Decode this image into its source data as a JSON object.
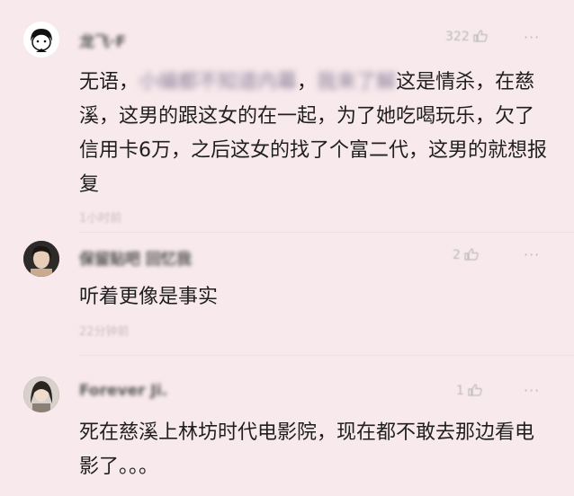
{
  "comments": [
    {
      "name": "龙飞·F",
      "likes": "322",
      "more": "···",
      "text": {
        "pre": "无语，",
        "blur1": "小编都不知道内幕",
        "mid": "，",
        "blur2": "我来了解",
        "post": "这是情杀，在慈溪，这男的跟这女的在一起，为了她吃喝玩乐，欠了信用卡6万，之后这女的找了个富二代，这男的就想报复"
      },
      "time": "1小时前"
    },
    {
      "name": "保留贴吧 回忆我",
      "likes": "2",
      "more": "···",
      "text": "听着更像是事实",
      "time": "22分钟前"
    },
    {
      "name": "Forever Ji.",
      "likes": "1",
      "more": "···",
      "text": "死在慈溪上林坊时代电影院，现在都不敢去那边看电影了。。。"
    }
  ]
}
